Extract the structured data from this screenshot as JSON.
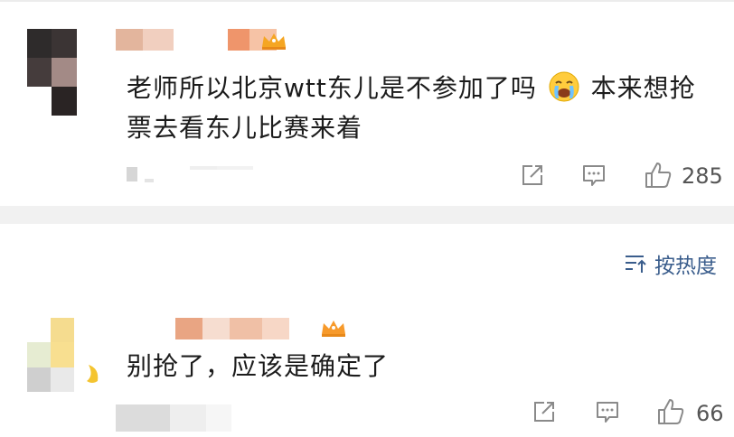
{
  "comments": [
    {
      "text_line_1": "老师所以北京wtt东儿是不参加了吗",
      "text_line_1_suffix": "本来想抢",
      "text_line_2": "票去看东儿比赛来着",
      "emoji": "crying-face-icon",
      "likes": "285"
    },
    {
      "text_line_1": "别抢了，应该是确定了",
      "likes": "66"
    }
  ],
  "sort": {
    "label": "按热度",
    "icon": "sort-lines-icon"
  },
  "colors": {
    "link_blue": "#3a5d8c",
    "icon_gray": "#8a8a8a",
    "divider": "#f1f1f1",
    "crown_orange": "#f5a623"
  }
}
